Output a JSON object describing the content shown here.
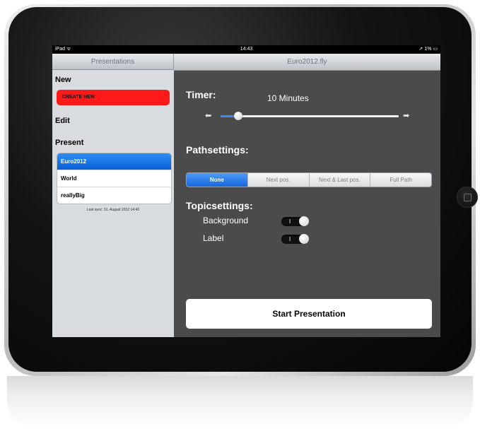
{
  "status": {
    "device": "iPad",
    "time": "14:43",
    "battery": "1%"
  },
  "master": {
    "title": "Presentations",
    "sections": {
      "new": "New",
      "edit": "Edit",
      "present": "Present"
    },
    "create_label": "CREATE NEW",
    "items": [
      {
        "label": "Euro2012",
        "selected": true
      },
      {
        "label": "World",
        "selected": false
      },
      {
        "label": "reallyBig",
        "selected": false
      }
    ],
    "last_sync": "Last sync: 31. August 2012 14:43"
  },
  "detail": {
    "title": "Euro2012.fly",
    "timer_label": "Timer:",
    "timer_value": "10 Minutes",
    "timer_slider_fraction": 0.1,
    "path_label": "Pathsettings:",
    "path_options": [
      "None",
      "Next pos.",
      "Next & Last pos.",
      "Full Path"
    ],
    "path_selected": "None",
    "topic_label": "Topicsettings:",
    "toggles": [
      {
        "label": "Background",
        "state": "I"
      },
      {
        "label": "Label",
        "state": "I"
      }
    ],
    "start_label": "Start Presentation"
  },
  "colors": {
    "accent": "#1767de",
    "create": "#ff1a1a",
    "detail_bg": "#4b4b4b",
    "master_bg": "#d8dbe0"
  }
}
